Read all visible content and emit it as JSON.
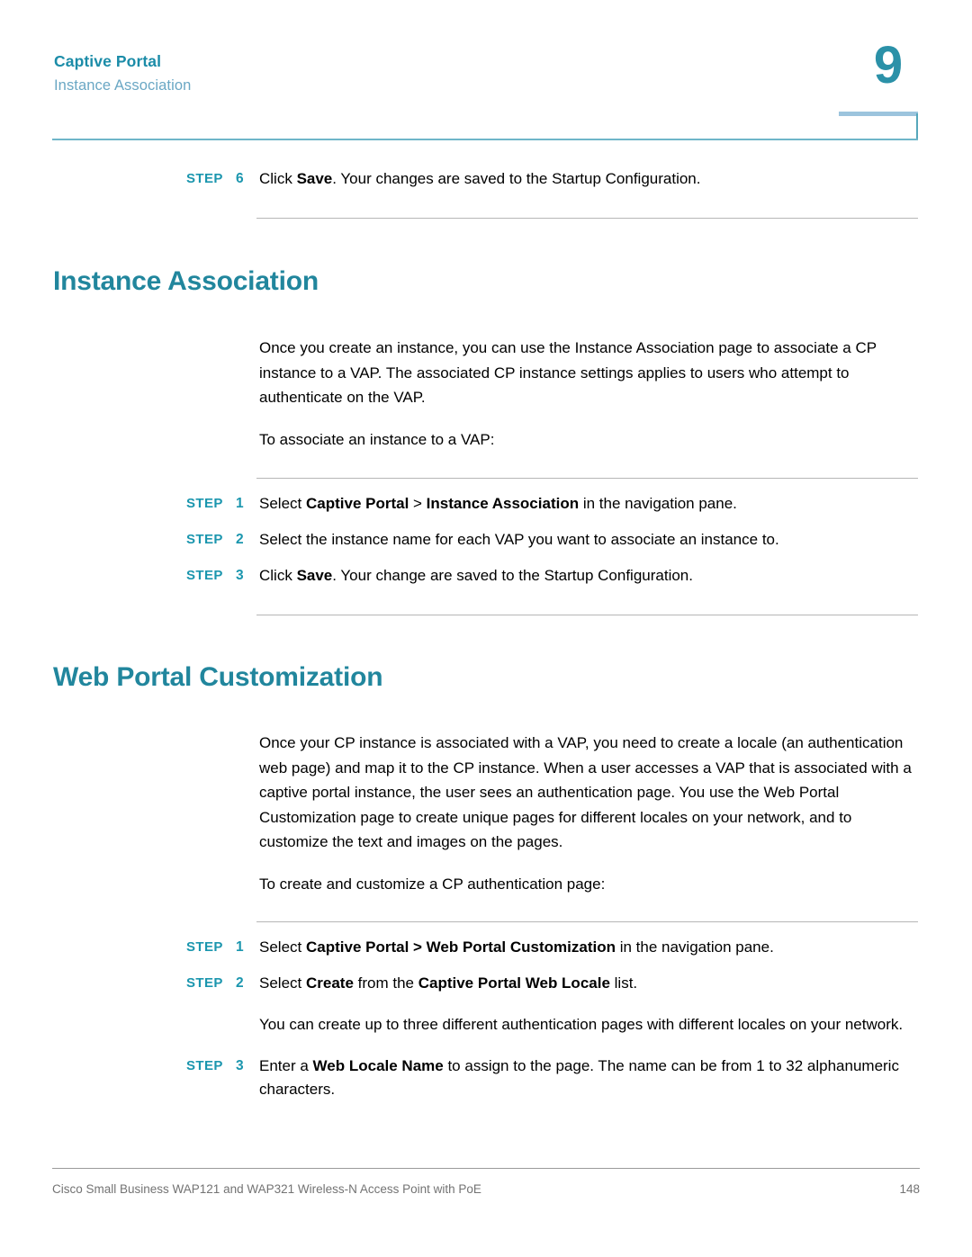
{
  "header": {
    "chapter_title": "Captive Portal",
    "section_title": "Instance Association",
    "chapter_number": "9"
  },
  "colors": {
    "heading_teal": "#21869d",
    "header_title_teal": "#1b8ca8",
    "header_subtitle_blue": "#6aa7c4",
    "step_label_teal": "#1b96ae",
    "header_rule_teal": "#6fb6c9",
    "header_stub_blue": "#9cc4dd",
    "body_rule_gray": "#b6b6b6",
    "footer_gray": "#737373"
  },
  "blocks": {
    "top_step": {
      "keyword": "STEP",
      "number": "6",
      "parts": [
        {
          "text": "Click ",
          "bold": false
        },
        {
          "text": "Save",
          "bold": true
        },
        {
          "text": ". Your changes are saved to the Startup Configuration.",
          "bold": false
        }
      ]
    },
    "instance_association": {
      "heading": "Instance Association",
      "paragraph_1": "Once you create an instance, you can use the Instance Association page to associate a CP instance to a VAP. The associated CP instance settings applies to users who attempt to authenticate on the VAP.",
      "paragraph_2": "To associate an instance to a VAP:",
      "steps": [
        {
          "keyword": "STEP",
          "number": "1",
          "parts": [
            {
              "text": "Select ",
              "bold": false
            },
            {
              "text": "Captive Portal",
              "bold": true
            },
            {
              "text": " > ",
              "bold": false
            },
            {
              "text": "Instance Association",
              "bold": true
            },
            {
              "text": " in the navigation pane.",
              "bold": false
            }
          ]
        },
        {
          "keyword": "STEP",
          "number": "2",
          "parts": [
            {
              "text": "Select the instance name for each VAP you want to associate an instance to.",
              "bold": false
            }
          ]
        },
        {
          "keyword": "STEP",
          "number": "3",
          "parts": [
            {
              "text": "Click ",
              "bold": false
            },
            {
              "text": "Save",
              "bold": true
            },
            {
              "text": ". Your change are saved to the Startup Configuration.",
              "bold": false
            }
          ]
        }
      ]
    },
    "web_portal_customization": {
      "heading": "Web Portal Customization",
      "paragraph_1": "Once your CP instance is associated with a VAP, you need to create a locale (an authentication web page) and map it to the CP instance. When a user accesses a VAP that is associated with a captive portal instance, the user sees an authentication page. You use the Web Portal Customization page to create unique pages for different locales on your network, and to customize the text and images on the pages.",
      "paragraph_2": "To create and customize a CP authentication page:",
      "steps": [
        {
          "keyword": "STEP",
          "number": "1",
          "parts": [
            {
              "text": "Select ",
              "bold": false
            },
            {
              "text": "Captive Portal > Web Portal Customization",
              "bold": true
            },
            {
              "text": " in the navigation pane.",
              "bold": false
            }
          ]
        },
        {
          "keyword": "STEP",
          "number": "2",
          "parts": [
            {
              "text": "Select ",
              "bold": false
            },
            {
              "text": "Create",
              "bold": true
            },
            {
              "text": " from the ",
              "bold": false
            },
            {
              "text": "Captive Portal Web Locale",
              "bold": true
            },
            {
              "text": " list.",
              "bold": false
            }
          ]
        }
      ],
      "note_after_step_2": "You can create up to three different authentication pages with different locales on your network.",
      "step_3": {
        "keyword": "STEP",
        "number": "3",
        "parts": [
          {
            "text": "Enter a ",
            "bold": false
          },
          {
            "text": "Web Locale Name",
            "bold": true
          },
          {
            "text": " to assign to the page. The name can be from 1 to 32 alphanumeric characters.",
            "bold": false
          }
        ]
      }
    }
  },
  "footer": {
    "text": "Cisco Small Business WAP121 and WAP321 Wireless-N Access Point with PoE",
    "page_number": "148"
  }
}
